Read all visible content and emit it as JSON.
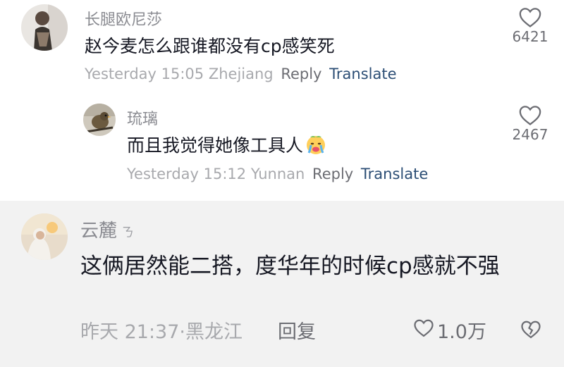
{
  "comments": [
    {
      "username": "长腿欧尼莎",
      "text": "赵今麦怎么跟谁都没有cp感笑死",
      "time": "Yesterday 15:05",
      "location": "Zhejiang",
      "reply_label": "Reply",
      "translate_label": "Translate",
      "likes": "6421",
      "avatar_icon": "user-avatar-photo"
    },
    {
      "username": "琉璃",
      "text": "而且我觉得她像工具人",
      "emoji_icon": "crying-face-emoji",
      "time": "Yesterday 15:12",
      "location": "Yunnan",
      "reply_label": "Reply",
      "translate_label": "Translate",
      "likes": "2467",
      "avatar_icon": "bird-avatar-photo"
    },
    {
      "username": "云麓",
      "username_tag": "ㄋ",
      "text": "这俩居然能二搭，度华年的时候cp感就不强",
      "time_location": "昨天 21:37·黑龙江",
      "reply_label": "回复",
      "likes": "1.0万",
      "avatar_icon": "user-avatar-photo"
    }
  ],
  "colors": {
    "text_primary": "#161823",
    "text_secondary": "#8a8b91",
    "translate_link": "#2c4e75",
    "highlight_bg": "#f2f2f2"
  }
}
